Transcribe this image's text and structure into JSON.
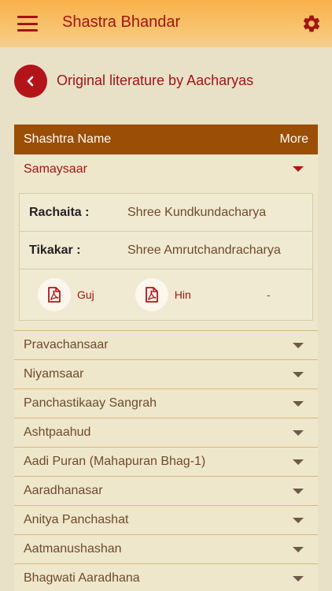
{
  "header": {
    "title": "Shastra Bhandar",
    "menu_icon": "hamburger-menu-icon",
    "settings_icon": "gear-icon",
    "color": "#a31414",
    "gradient": [
      "#f9b14a",
      "#f5cf8c"
    ]
  },
  "page": {
    "title": "Original literature by Aacharyas",
    "back_icon": "chevron-left-icon"
  },
  "table": {
    "columns": [
      "Shashtra Name",
      "More"
    ],
    "expanded": {
      "name": "Samaysaar",
      "details": [
        {
          "label": "Rachaita :",
          "value": "Shree Kundkundacharya"
        },
        {
          "label": "Tikakar :",
          "value": "Shree Amrutchandracharya"
        }
      ],
      "downloads": [
        {
          "label": "Guj",
          "icon": "pdf-icon"
        },
        {
          "label": "Hin",
          "icon": "pdf-icon"
        }
      ],
      "extra": "-"
    },
    "rows": [
      "Pravachansaar",
      "Niyamsaar",
      "Panchastikaay Sangrah",
      "Ashtpaahud",
      "Aadi Puran (Mahapuran Bhag-1)",
      "Aaradhanasar",
      "Anitya Panchashat",
      "Aatmanushashan",
      "Bhagwati Aaradhana"
    ]
  },
  "colors": {
    "accent": "#a31414",
    "header_bar": "#9b4e06",
    "background": "#e8e1c8"
  }
}
